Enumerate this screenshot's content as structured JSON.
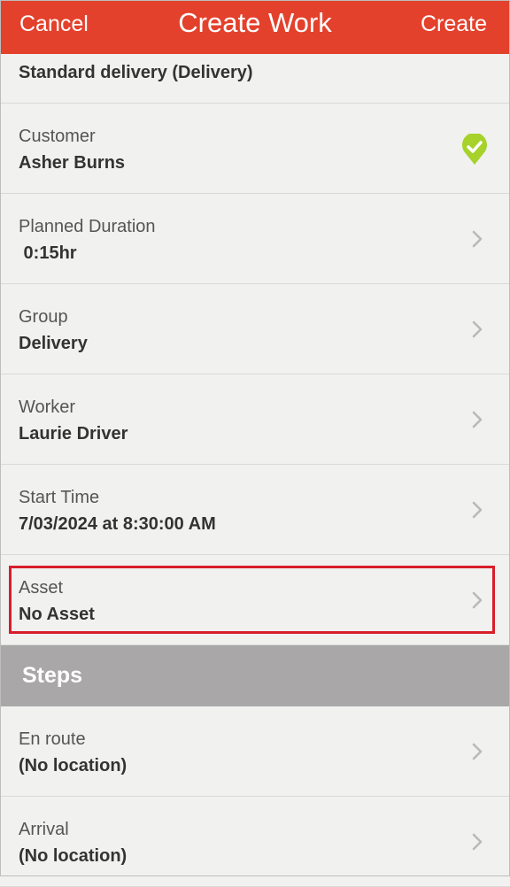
{
  "nav": {
    "cancel": "Cancel",
    "title": "Create Work",
    "create": "Create"
  },
  "rows": [
    {
      "label": "",
      "value": "Standard delivery (Delivery)"
    },
    {
      "label": "Customer",
      "value": "Asher Burns"
    },
    {
      "label": "Planned Duration",
      "value": " 0:15hr"
    },
    {
      "label": "Group",
      "value": "Delivery"
    },
    {
      "label": "Worker",
      "value": "Laurie Driver"
    },
    {
      "label": "Start Time",
      "value": "7/03/2024 at 8:30:00 AM"
    },
    {
      "label": "Asset",
      "value": "No Asset"
    }
  ],
  "steps": {
    "title": "Steps",
    "items": [
      {
        "label": "En route",
        "value": "(No location)"
      },
      {
        "label": "Arrival",
        "value": "(No location)"
      }
    ]
  },
  "colors": {
    "accent": "#e3412c",
    "check": "#a6d22b",
    "highlight": "#d81e2a",
    "section": "#a9a7a8"
  },
  "icons": {
    "chevron": "chevron-right-icon",
    "check": "verified-location-icon"
  }
}
